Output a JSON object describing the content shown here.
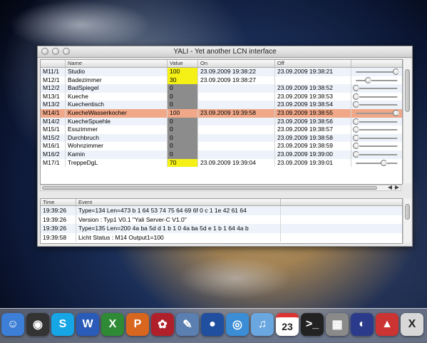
{
  "window": {
    "title": "YALI - Yet another LCN interface"
  },
  "outputs_table": {
    "headers": [
      "Name",
      "Value",
      "On",
      "Off"
    ],
    "rows": [
      {
        "id": "M11/1",
        "name": "Studio",
        "value": "100",
        "on": "23.09.2009 19:38:22",
        "off": "23.09.2009 19:38:21",
        "level": 1.0,
        "value_style": "yellow"
      },
      {
        "id": "M12/1",
        "name": "Badezimmer",
        "value": "30",
        "on": "23.09.2009 19:38:27",
        "off": "",
        "level": 0.3,
        "value_style": "yellow"
      },
      {
        "id": "M12/2",
        "name": "BadSpiegel",
        "value": "0",
        "on": "",
        "off": "23.09.2009 19:38:52",
        "level": 0,
        "value_style": "grey"
      },
      {
        "id": "M13/1",
        "name": "Kueche",
        "value": "0",
        "on": "",
        "off": "23.09.2009 19:38:53",
        "level": 0,
        "value_style": "grey"
      },
      {
        "id": "M13/2",
        "name": "Kuechentisch",
        "value": "0",
        "on": "",
        "off": "23.09.2009 19:38:54",
        "level": 0,
        "value_style": "grey"
      },
      {
        "id": "M14/1",
        "name": "KuecheWasserkocher",
        "value": "100",
        "on": "23.09.2009 19:39:58",
        "off": "23.09.2009 19:38:55",
        "level": 1.0,
        "value_style": "selected",
        "selected": true
      },
      {
        "id": "M14/2",
        "name": "KuecheSpuehle",
        "value": "0",
        "on": "",
        "off": "23.09.2009 19:38:56",
        "level": 0,
        "value_style": "grey"
      },
      {
        "id": "M15/1",
        "name": "Esszimmer",
        "value": "0",
        "on": "",
        "off": "23.09.2009 19:38:57",
        "level": 0,
        "value_style": "grey"
      },
      {
        "id": "M15/2",
        "name": "Durchbruch",
        "value": "0",
        "on": "",
        "off": "23.09.2009 19:38:58",
        "level": 0,
        "value_style": "grey"
      },
      {
        "id": "M16/1",
        "name": "Wohnzimmer",
        "value": "0",
        "on": "",
        "off": "23.09.2009 19:38:59",
        "level": 0,
        "value_style": "grey"
      },
      {
        "id": "M16/2",
        "name": "Kamin",
        "value": "0",
        "on": "",
        "off": "23.09.2009 19:39:00",
        "level": 0,
        "value_style": "grey"
      },
      {
        "id": "M17/1",
        "name": "TreppeDgL",
        "value": "70",
        "on": "23.09.2009 19:39:04",
        "off": "23.09.2009 19:39:01",
        "level": 0.7,
        "value_style": "yellow"
      }
    ]
  },
  "log_table": {
    "headers": [
      "Time",
      "Event"
    ],
    "rows": [
      {
        "time": "19:39:26",
        "event": "Type=134 Len=473 b 1 64 53 74 75 64 69 6f 0 c 1 1e 42 61 64"
      },
      {
        "time": "19:39:26",
        "event": "Version : Typ1 V0.1 \"Yali Server-C V1.0\""
      },
      {
        "time": "19:39:26",
        "event": "Type=135 Len=200 4a ba 5d d 1 b 1 0 4a ba 5d e 1 b 1 64 4a b"
      },
      {
        "time": "19:39:58",
        "event": "Licht Status : M14 Output1=100"
      }
    ]
  },
  "dock": {
    "calendar_day": "23",
    "items": [
      {
        "name": "finder-icon",
        "color": "#3d7fd6",
        "glyph": "☺"
      },
      {
        "name": "dashboard-icon",
        "color": "#333333",
        "glyph": "◉"
      },
      {
        "name": "skype-icon",
        "color": "#16a6e6",
        "glyph": "S"
      },
      {
        "name": "word-icon",
        "color": "#2a5bb8",
        "glyph": "W"
      },
      {
        "name": "excel-icon",
        "color": "#2f8a35",
        "glyph": "X"
      },
      {
        "name": "powerpoint-icon",
        "color": "#d9661f",
        "glyph": "P"
      },
      {
        "name": "photo-booth-icon",
        "color": "#b0202a",
        "glyph": "✿"
      },
      {
        "name": "preview-icon",
        "color": "#5a7fb0",
        "glyph": "✎"
      },
      {
        "name": "google-earth-icon",
        "color": "#1f4f9e",
        "glyph": "●"
      },
      {
        "name": "safari-icon",
        "color": "#3b8ed6",
        "glyph": "◎"
      },
      {
        "name": "itunes-icon",
        "color": "#6aa7e0",
        "glyph": "♫"
      },
      {
        "name": "ical-icon",
        "color": "#ffffff",
        "glyph": ""
      },
      {
        "name": "terminal-icon",
        "color": "#222222",
        "glyph": ">_"
      },
      {
        "name": "calculator-icon",
        "color": "#8a8a8a",
        "glyph": "▦"
      },
      {
        "name": "eclipse-icon",
        "color": "#2b3a8a",
        "glyph": "◐"
      },
      {
        "name": "activity-monitor-icon",
        "color": "#cc3333",
        "glyph": "▲"
      },
      {
        "name": "x11-icon",
        "color": "#d8d8d8",
        "glyph": "X"
      }
    ]
  }
}
